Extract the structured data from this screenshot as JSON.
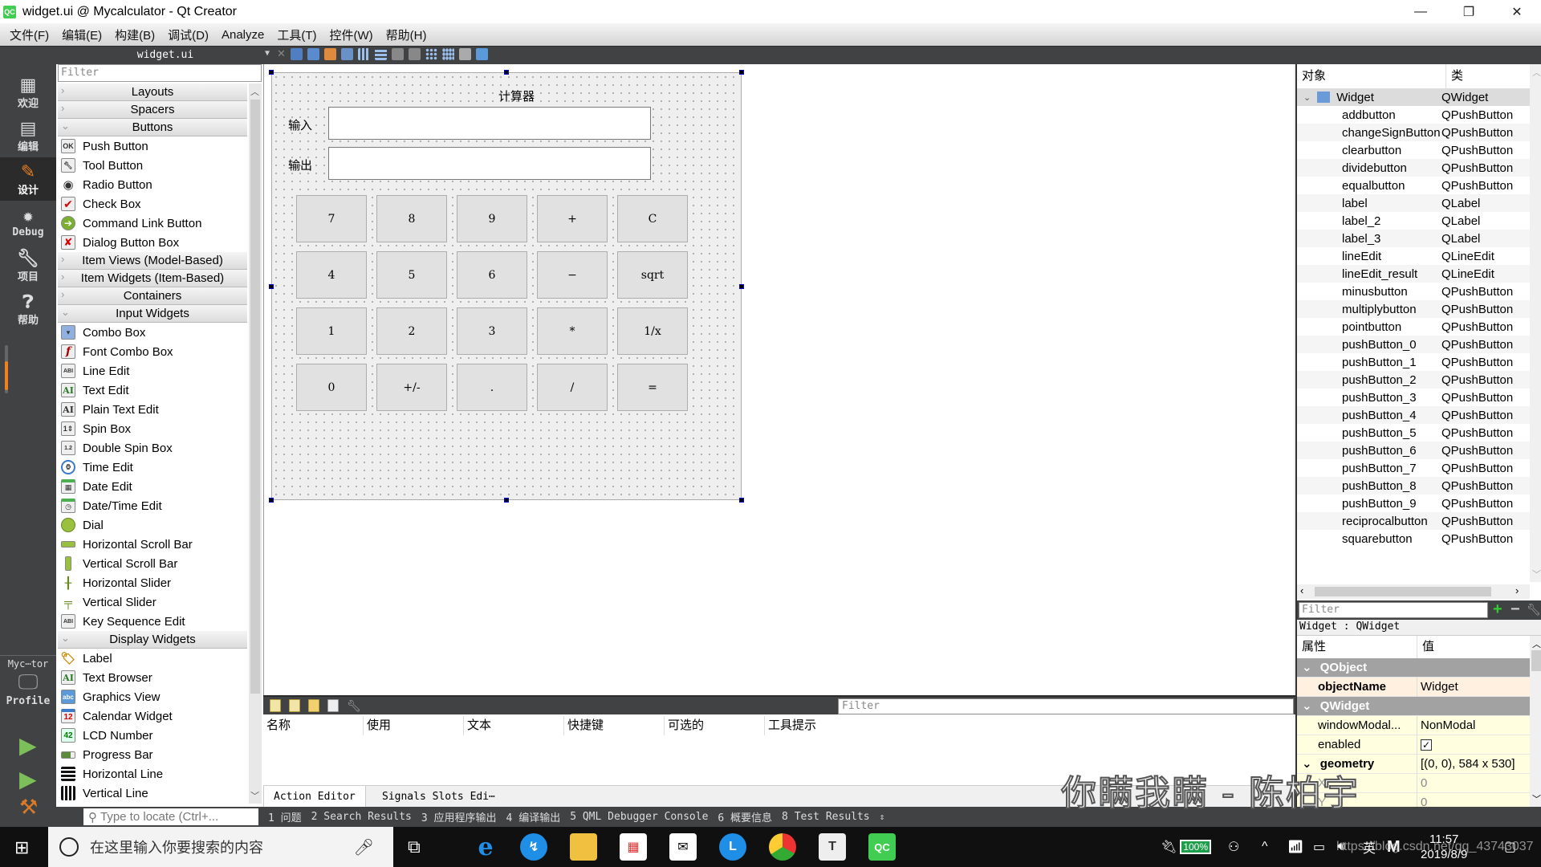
{
  "window": {
    "title": "widget.ui @ Mycalculator - Qt Creator",
    "app_icon": "QC",
    "controls": {
      "minimize": "—",
      "maximize": "❐",
      "close": "✕"
    }
  },
  "menubar": [
    "文件(F)",
    "编辑(E)",
    "构建(B)",
    "调试(D)",
    "Analyze",
    "工具(T)",
    "控件(W)",
    "帮助(H)"
  ],
  "editor_toolbar": {
    "file_name": "widget.ui",
    "icons": [
      "edit-widgets-icon",
      "edit-signals-slots-icon",
      "edit-buddies-icon",
      "edit-tab-order-icon",
      "layout-horizontal-icon",
      "layout-vertical-icon",
      "layout-horizontal-splitter-icon",
      "layout-vertical-splitter-icon",
      "layout-grid-icon",
      "layout-form-icon",
      "break-layout-icon",
      "adjust-size-icon"
    ]
  },
  "modebar": {
    "modes": [
      {
        "label": "欢迎",
        "icon": "grid-icon"
      },
      {
        "label": "编辑",
        "icon": "document-icon"
      },
      {
        "label": "设计",
        "icon": "pencil-icon",
        "active": true
      },
      {
        "label": "Debug",
        "icon": "bug-icon"
      },
      {
        "label": "项目",
        "icon": "wrench-icon"
      },
      {
        "label": "帮助",
        "icon": "help-icon"
      }
    ],
    "kit": {
      "project": "Myc⋯tor",
      "build": "Profile"
    },
    "actions": [
      "run-icon",
      "debug-run-icon",
      "build-hammer-icon"
    ]
  },
  "widget_box": {
    "filter_placeholder": "Filter",
    "sections": [
      {
        "title": "Layouts",
        "expanded": false,
        "items": []
      },
      {
        "title": "Spacers",
        "expanded": false,
        "items": []
      },
      {
        "title": "Buttons",
        "expanded": true,
        "items": [
          "Push Button",
          "Tool Button",
          "Radio Button",
          "Check Box",
          "Command Link Button",
          "Dialog Button Box"
        ]
      },
      {
        "title": "Item Views (Model-Based)",
        "expanded": false,
        "items": []
      },
      {
        "title": "Item Widgets (Item-Based)",
        "expanded": false,
        "items": []
      },
      {
        "title": "Containers",
        "expanded": false,
        "items": []
      },
      {
        "title": "Input Widgets",
        "expanded": true,
        "items": [
          "Combo Box",
          "Font Combo Box",
          "Line Edit",
          "Text Edit",
          "Plain Text Edit",
          "Spin Box",
          "Double Spin Box",
          "Time Edit",
          "Date Edit",
          "Date/Time Edit",
          "Dial",
          "Horizontal Scroll Bar",
          "Vertical Scroll Bar",
          "Horizontal Slider",
          "Vertical Slider",
          "Key Sequence Edit"
        ]
      },
      {
        "title": "Display Widgets",
        "expanded": true,
        "items": [
          "Label",
          "Text Browser",
          "Graphics View",
          "Calendar Widget",
          "LCD Number",
          "Progress Bar",
          "Horizontal Line",
          "Vertical Line"
        ]
      }
    ]
  },
  "form": {
    "title_label": "计算器",
    "input_label": "输入",
    "output_label": "输出",
    "input_value": "",
    "output_value": "",
    "buttons": [
      [
        "7",
        "8",
        "9",
        "+",
        "C"
      ],
      [
        "4",
        "5",
        "6",
        "−",
        "sqrt"
      ],
      [
        "1",
        "2",
        "3",
        "*",
        "1/x"
      ],
      [
        "0",
        "+/-",
        ".",
        "/",
        "="
      ]
    ]
  },
  "action_editor": {
    "filter_placeholder": "Filter",
    "columns": [
      "名称",
      "使用",
      "文本",
      "快捷键",
      "可选的",
      "工具提示"
    ],
    "tabs": [
      "Action Editor",
      "Signals  Slots Edi⋯"
    ]
  },
  "object_inspector": {
    "headers": [
      "对象",
      "类"
    ],
    "root": {
      "name": "Widget",
      "class": "QWidget"
    },
    "children": [
      {
        "name": "addbutton",
        "class": "QPushButton"
      },
      {
        "name": "changeSignButton",
        "class": "QPushButton"
      },
      {
        "name": "clearbutton",
        "class": "QPushButton"
      },
      {
        "name": "dividebutton",
        "class": "QPushButton"
      },
      {
        "name": "equalbutton",
        "class": "QPushButton"
      },
      {
        "name": "label",
        "class": "QLabel"
      },
      {
        "name": "label_2",
        "class": "QLabel"
      },
      {
        "name": "label_3",
        "class": "QLabel"
      },
      {
        "name": "lineEdit",
        "class": "QLineEdit"
      },
      {
        "name": "lineEdit_result",
        "class": "QLineEdit"
      },
      {
        "name": "minusbutton",
        "class": "QPushButton"
      },
      {
        "name": "multiplybutton",
        "class": "QPushButton"
      },
      {
        "name": "pointbutton",
        "class": "QPushButton"
      },
      {
        "name": "pushButton_0",
        "class": "QPushButton"
      },
      {
        "name": "pushButton_1",
        "class": "QPushButton"
      },
      {
        "name": "pushButton_2",
        "class": "QPushButton"
      },
      {
        "name": "pushButton_3",
        "class": "QPushButton"
      },
      {
        "name": "pushButton_4",
        "class": "QPushButton"
      },
      {
        "name": "pushButton_5",
        "class": "QPushButton"
      },
      {
        "name": "pushButton_6",
        "class": "QPushButton"
      },
      {
        "name": "pushButton_7",
        "class": "QPushButton"
      },
      {
        "name": "pushButton_8",
        "class": "QPushButton"
      },
      {
        "name": "pushButton_9",
        "class": "QPushButton"
      },
      {
        "name": "reciprocalbutton",
        "class": "QPushButton"
      },
      {
        "name": "squarebutton",
        "class": "QPushButton"
      }
    ]
  },
  "property_editor": {
    "filter_placeholder": "Filter",
    "class_line": "Widget : QWidget",
    "headers": [
      "属性",
      "值"
    ],
    "rows": [
      {
        "type": "group",
        "key": "QObject"
      },
      {
        "type": "prop",
        "key": "objectName",
        "value": "Widget",
        "bold": true,
        "style": "peach"
      },
      {
        "type": "group",
        "key": "QWidget"
      },
      {
        "type": "prop",
        "key": "windowModal...",
        "value": "NonModal",
        "style": "yellow"
      },
      {
        "type": "prop",
        "key": "enabled",
        "value": "☑",
        "style": "yellow",
        "checkbox": true
      },
      {
        "type": "prop",
        "key": "geometry",
        "value": "[(0, 0), 584 x 530]",
        "bold": true,
        "expandable": true,
        "style": "yellow"
      },
      {
        "type": "prop",
        "key": "X",
        "value": "0",
        "style": "yellow",
        "dim": true
      },
      {
        "type": "prop",
        "key": "Y",
        "value": "0",
        "style": "yellow",
        "dim": true
      }
    ]
  },
  "output_bar": {
    "locate_placeholder": "Type to locate (Ctrl+...",
    "tabs": [
      "1 问题",
      "2 Search Results",
      "3 应用程序输出",
      "4 编译输出",
      "5 QML Debugger Console",
      "6 概要信息",
      "8 Test Results"
    ]
  },
  "taskbar": {
    "search_placeholder": "在这里输入你要搜索的内容",
    "apps": [
      "edge-icon",
      "sync-app-icon",
      "file-explorer-icon",
      "store-icon",
      "mail-icon",
      "clock-app-icon",
      "chrome-icon",
      "typora-icon",
      "qt-creator-icon"
    ],
    "battery": "100%",
    "ime": "英",
    "time": "11:57",
    "date": "2019/8/9"
  },
  "overlay": {
    "subtitle": "你瞒我瞒 - 陈柏宇",
    "watermark": "https://blog.csdn.net/qq_43743037"
  },
  "colors": {
    "dark_chrome": "#404244",
    "group_row": "#a2a2a2",
    "property_yellow": "#ffffe0",
    "property_peach": "#fff0e0",
    "selection_handle": "#000080",
    "qt_green": "#41cd52"
  }
}
